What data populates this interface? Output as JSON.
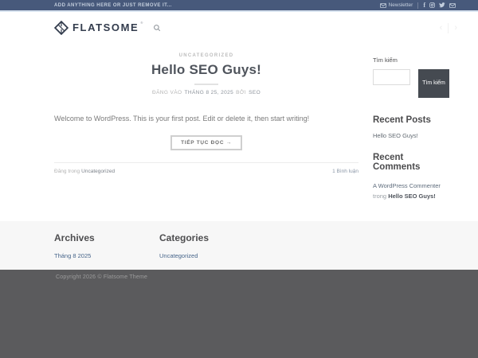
{
  "colors": {
    "topbar_bg": "#47597b",
    "topbar_accent": "#d9e4f0",
    "brand_text": "#333c4d",
    "link_blue": "#47658a",
    "search_button_bg": "#454a51",
    "footer_bg": "#f7f7f7",
    "absolute_footer_bg": "#5b5b5d"
  },
  "topbar": {
    "message": "ADD ANYTHING HERE OR JUST REMOVE IT...",
    "newsletter_label": "Newsletter",
    "social": [
      {
        "name": "facebook-icon",
        "glyph": "f"
      },
      {
        "name": "instagram-icon"
      },
      {
        "name": "twitter-icon"
      },
      {
        "name": "email-icon"
      }
    ]
  },
  "header": {
    "brand": "FLATSOME",
    "registered_mark": "®"
  },
  "post": {
    "category": "UNCATEGORIZED",
    "title": "Hello SEO Guys!",
    "meta": {
      "posted_prefix": "ĐĂNG VÀO",
      "date": "THÁNG 8 25, 2025",
      "by": "BỞI",
      "author": "SEO"
    },
    "excerpt": "Welcome to WordPress. This is your first post. Edit or delete it, then start writing!",
    "read_more": "TIẾP TỤC ĐỌC →",
    "footer_meta": {
      "posted_in": "Đăng trong",
      "category_link": "Uncategorized",
      "comments": "1 Bình luận"
    }
  },
  "sidebar": {
    "search": {
      "label": "Tìm kiếm",
      "button": "Tìm kiếm"
    },
    "recent_posts": {
      "title": "Recent Posts",
      "items": [
        "Hello SEO Guys!"
      ]
    },
    "recent_comments": {
      "title": "Recent Comments",
      "items": [
        {
          "author": "A WordPress Commenter",
          "separator": " trong ",
          "post": "Hello SEO Guys!"
        }
      ]
    }
  },
  "footer": {
    "columns": [
      {
        "title": "Archives",
        "links": [
          "Tháng 8 2025"
        ]
      },
      {
        "title": "Categories",
        "links": [
          "Uncategorized"
        ]
      }
    ],
    "copyright": "Copyright 2026 © Flatsome Theme"
  }
}
